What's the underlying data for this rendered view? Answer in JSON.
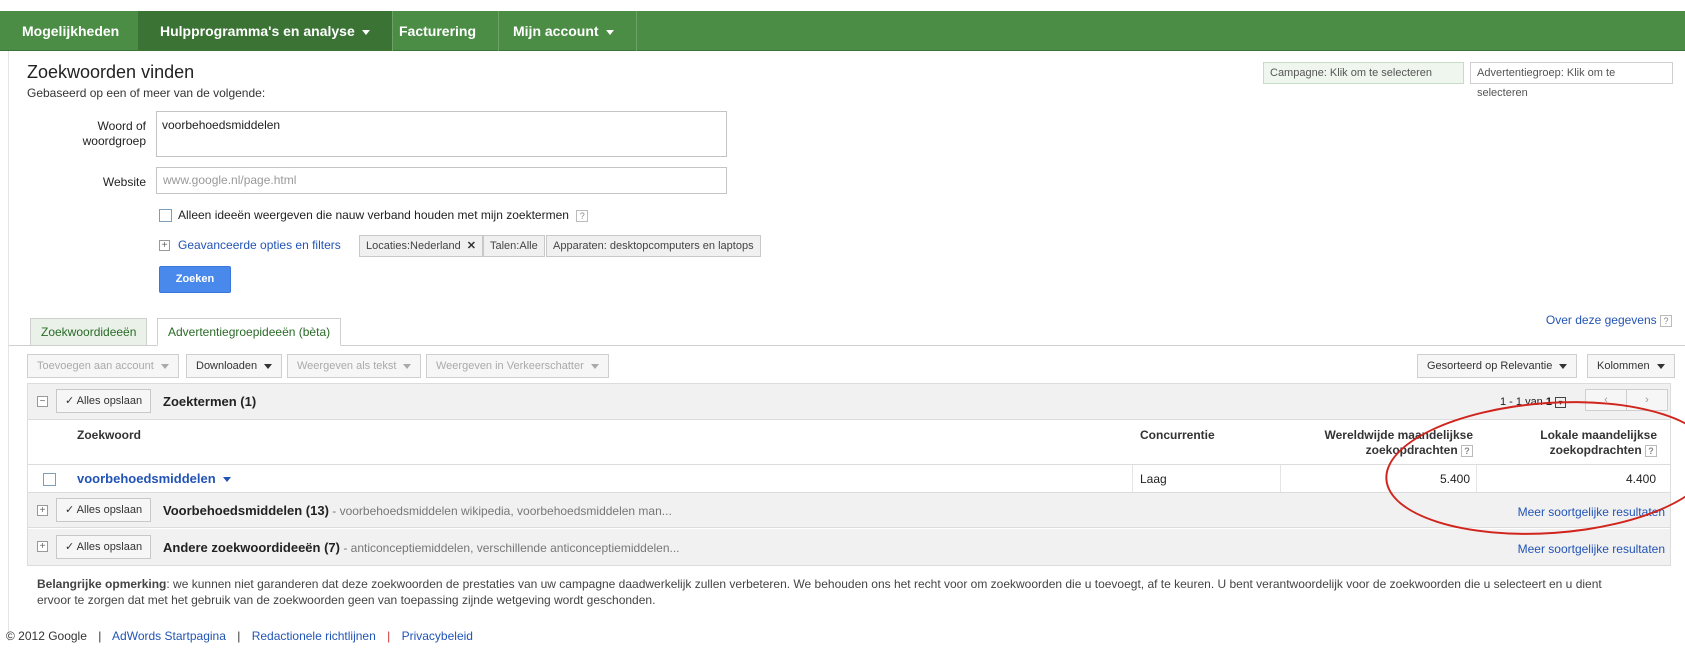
{
  "nav": {
    "items": [
      {
        "label": "Mogelijkheden",
        "dropdown": false
      },
      {
        "label": "Hulpprogramma's en analyse",
        "dropdown": true
      },
      {
        "label": "Facturering",
        "dropdown": false
      },
      {
        "label": "Mijn account",
        "dropdown": true
      }
    ],
    "colors": {
      "bar": "#4c8d46",
      "active": "#3a7334"
    }
  },
  "header": {
    "title": "Zoekwoorden vinden",
    "subtitle": "Gebaseerd op een of meer van de volgende:",
    "campaign_selector": "Campagne: Klik om te selecteren",
    "adgroup_selector": "Advertentiegroep: Klik om te selecteren"
  },
  "form": {
    "word_label_line1": "Woord of",
    "word_label_line2": "woordgroep",
    "word_value": "voorbehoedsmiddelen",
    "website_label": "Website",
    "website_placeholder": "www.google.nl/page.html",
    "checkbox_label": "Alleen ideeën weergeven die nauw verband houden met mijn zoektermen",
    "advanced_link": "Geavanceerde opties en filters",
    "chips": {
      "locations": "Locaties:Nederland",
      "languages": "Talen:Alle",
      "devices": "Apparaten: desktopcomputers en laptops"
    },
    "search_button": "Zoeken"
  },
  "tabs": {
    "items": [
      "Zoekwoordideeën",
      "Advertentiegroepideeën (bèta)"
    ],
    "active": 1,
    "about_link": "Over deze gegevens"
  },
  "toolbar": {
    "add_to_account": "Toevoegen aan account",
    "download": "Downloaden",
    "show_as_text": "Weergeven als tekst",
    "show_in_estimator": "Weergeven in Verkeerschatter",
    "sort": "Gesorteerd op Relevantie",
    "columns": "Kolommen"
  },
  "results": {
    "save_all": "Alles opslaan",
    "group1_title": "Zoektermen (1)",
    "pager": {
      "text_prefix": "1 - 1 van",
      "total": "1"
    },
    "columns": {
      "keyword": "Zoekwoord",
      "competition": "Concurrentie",
      "global_line1": "Wereldwijde maandelijkse",
      "global_line2": "zoekopdrachten",
      "local_line1": "Lokale maandelijkse",
      "local_line2": "zoekopdrachten"
    },
    "row": {
      "keyword": "voorbehoedsmiddelen",
      "competition": "Laag",
      "global": "5.400",
      "local": "4.400"
    },
    "group2_title": "Voorbehoedsmiddelen (13)",
    "group2_sub": " - voorbehoedsmiddelen wikipedia, voorbehoedsmiddelen man...",
    "group3_title": "Andere zoekwoordideeën (7)",
    "group3_sub": " - anticonceptiemiddelen, verschillende anticonceptiemiddelen...",
    "more_similar": "Meer soortgelijke resultaten"
  },
  "note": {
    "bold": "Belangrijke opmerking",
    "text": ": we kunnen niet garanderen dat deze zoekwoorden de prestaties van uw campagne daadwerkelijk zullen verbeteren. We behouden ons het recht voor om zoekwoorden die u toevoegt, af te keuren. U bent verantwoordelijk voor de zoekwoorden die u selecteert en u dient ervoor te zorgen dat met het gebruik van de zoekwoorden geen van toepassing zijnde wetgeving wordt geschonden."
  },
  "footer": {
    "copyright": "© 2012 Google",
    "links": [
      "AdWords Startpagina",
      "Redactionele richtlijnen",
      "Privacybeleid"
    ]
  }
}
